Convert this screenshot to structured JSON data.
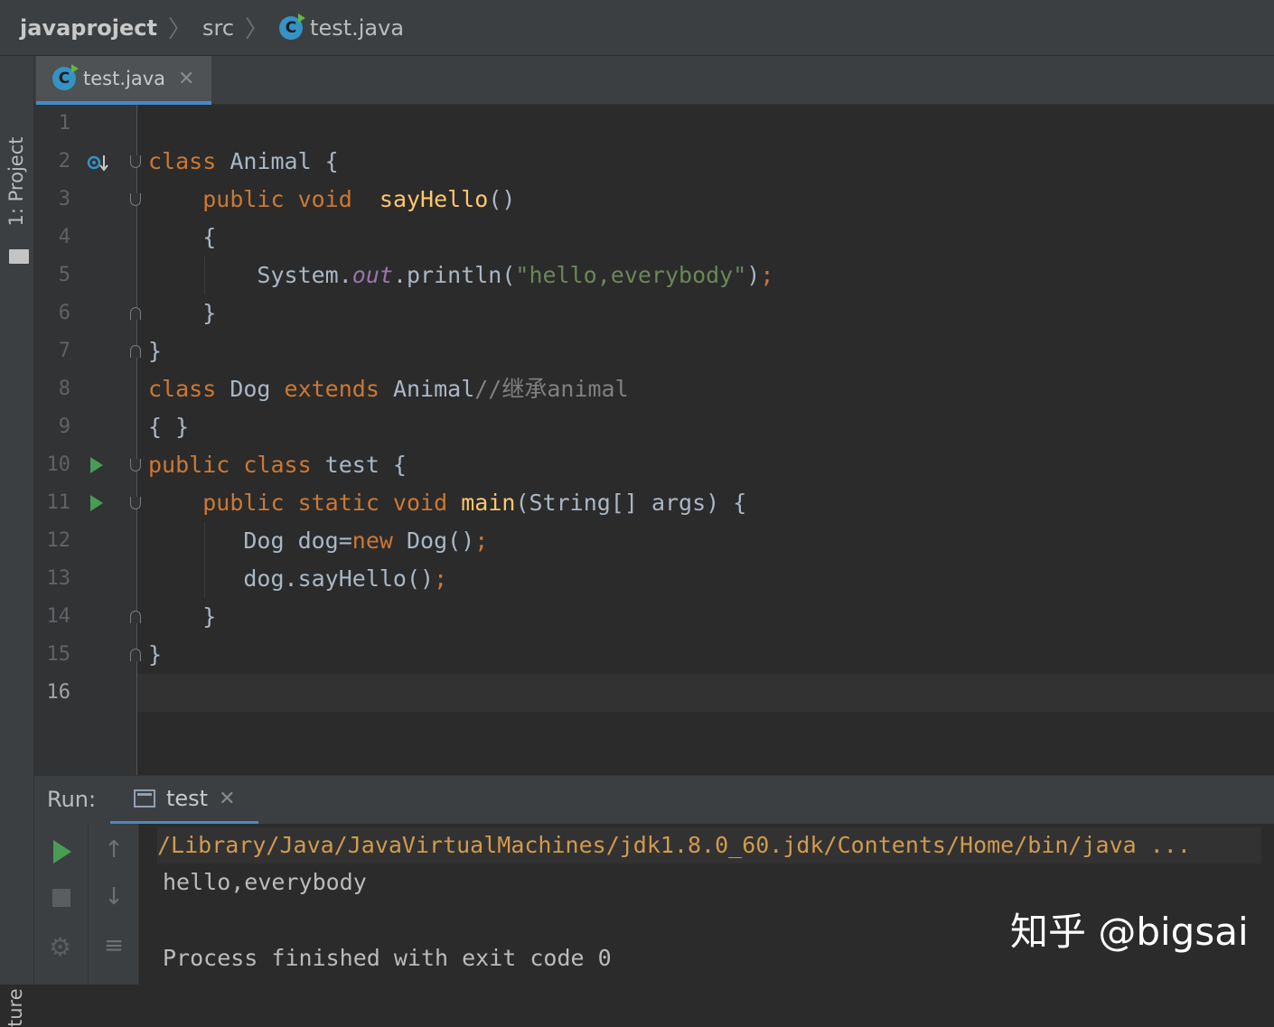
{
  "breadcrumb": {
    "project": "javaproject",
    "folder": "src",
    "file": "test.java"
  },
  "left_strip": {
    "project_tab": "1: Project",
    "structure_tab": "ture"
  },
  "editor_tab": {
    "label": "test.java"
  },
  "editor": {
    "line_numbers": [
      "1",
      "2",
      "3",
      "4",
      "5",
      "6",
      "7",
      "8",
      "9",
      "10",
      "11",
      "12",
      "13",
      "14",
      "15",
      "16"
    ],
    "current_line": "16"
  },
  "run_panel": {
    "label": "Run:",
    "tab": "test",
    "command": "/Library/Java/JavaVirtualMachines/jdk1.8.0_60.jdk/Contents/Home/bin/java ...",
    "output": "hello,everybody",
    "exit": "Process finished with exit code 0"
  },
  "watermark": "知乎 @bigsai",
  "icons": {
    "file_icon": "java-class-icon",
    "run_gutter": "run-gutter-icon",
    "override": "override-method-icon"
  },
  "colors": {
    "keyword": "#cc7832",
    "method": "#ffc66d",
    "string": "#6a8759",
    "field": "#9876aa",
    "comment": "#808080",
    "text": "#a9b7c6",
    "run_green": "#499c54"
  }
}
